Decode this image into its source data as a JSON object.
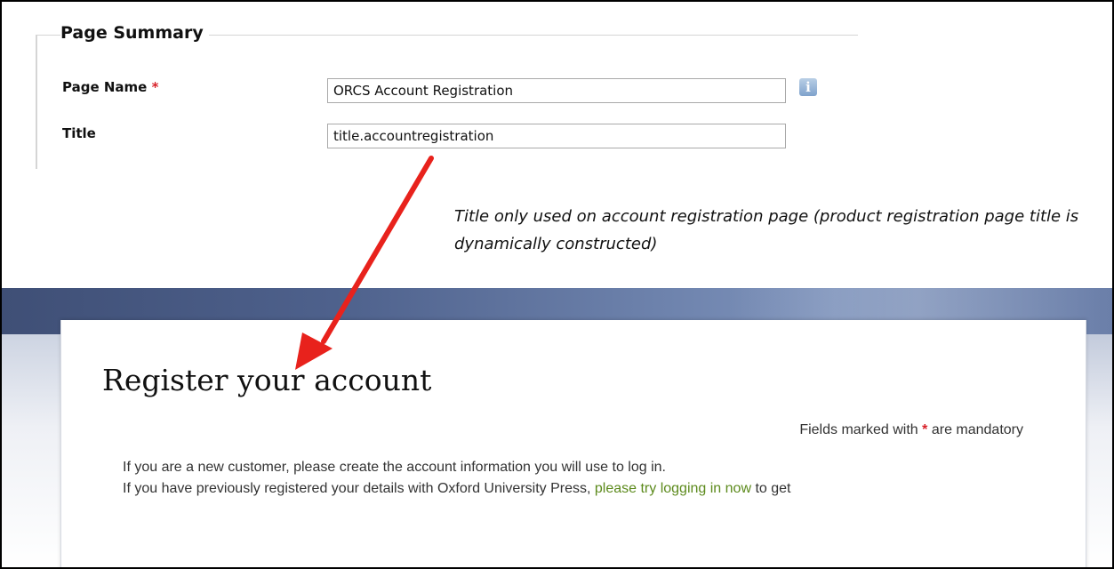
{
  "page_summary": {
    "legend": "Page Summary",
    "page_name_label": "Page Name",
    "required_marker": "*",
    "page_name_value": "ORCS Account Registration",
    "info_icon": "info-icon",
    "title_label": "Title",
    "title_value": "title.accountregistration"
  },
  "annotation": {
    "note": "Title only used on account registration page (product registration page title is dynamically constructed)",
    "arrow_color": "#e8221c"
  },
  "site": {
    "heading": "Register your account",
    "mandatory_prefix": "Fields marked with ",
    "mandatory_star": "*",
    "mandatory_suffix": " are mandatory",
    "line1": "If you are a new customer, please create the account information you will use to log in.",
    "line2_prefix": "If you have previously registered your details with Oxford University Press, ",
    "line2_link": "please try logging in now",
    "line2_suffix": " to get",
    "band_color": "#4e618c",
    "link_color": "#5c8a1c"
  }
}
